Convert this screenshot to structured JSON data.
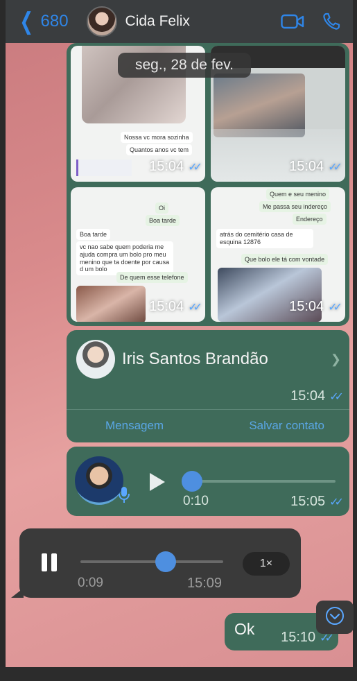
{
  "header": {
    "back_count": "680",
    "contact_name": "Cida Felix",
    "icons": [
      "chevron-left-icon",
      "video-camera-icon",
      "phone-icon"
    ]
  },
  "date_label": "seg., 28 de fev.",
  "image_grid": {
    "tiles": [
      {
        "time": "15:04",
        "snippets": [
          "Nossa vc mora sozinha",
          "Quantos anos vc tem"
        ]
      },
      {
        "time": "15:04",
        "snippets": []
      },
      {
        "time": "15:04",
        "snippets": [
          "Oi",
          "Boa tarde",
          "Boa tarde",
          "vc nao sabe quem poderia me ajuda compra um bolo pro meu menino que ta doente por causa d um bolo",
          "De quem esse telefone"
        ]
      },
      {
        "time": "15:04",
        "snippets": [
          "Quem e seu menino",
          "Me passa seu indereço",
          "Endereço",
          "atrás do cemitério casa de esquina 12876",
          "Que bolo ele tá com vontade"
        ]
      }
    ]
  },
  "contact_card": {
    "name": "Iris Santos Brandão",
    "time": "15:04",
    "message_button": "Mensagem",
    "save_button": "Salvar contato"
  },
  "audio_out": {
    "duration": "0:10",
    "time": "15:05",
    "progress": 0.0
  },
  "audio_in": {
    "duration": "0:09",
    "time": "15:09",
    "speed": "1×",
    "progress": 0.5
  },
  "ok_message": {
    "text": "Ok",
    "time": "15:10"
  },
  "colors": {
    "outgoing_bubble": "#3f6b5a",
    "incoming_bubble": "#3a3a3a",
    "accent_blue": "#2f86e8",
    "read_ticks": "#5aa7ff"
  }
}
